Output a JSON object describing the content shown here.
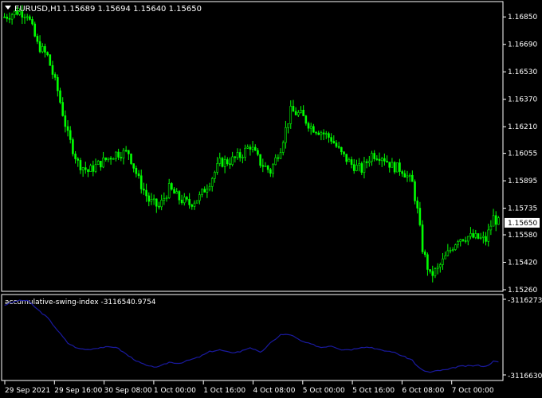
{
  "header": {
    "symbol": "EURUSD,H1",
    "ohlc": "1.15689 1.15694 1.15640 1.15650"
  },
  "price_axis": {
    "ticks": [
      "1.16850",
      "1.16690",
      "1.16530",
      "1.16370",
      "1.16210",
      "1.16055",
      "1.15895",
      "1.15735",
      "1.15580",
      "1.15420",
      "1.15260"
    ],
    "current": "1.15650"
  },
  "indicator": {
    "label": "accumulative-swing-index -3116540.9754",
    "top_value": "-3116273.",
    "bottom_value": "-3116630."
  },
  "time_axis": [
    "29 Sep 2021",
    "29 Sep 16:00",
    "30 Sep 08:00",
    "1 Oct 00:00",
    "1 Oct 16:00",
    "4 Oct 08:00",
    "5 Oct 00:00",
    "5 Oct 16:00",
    "6 Oct 08:00",
    "7 Oct 00:00"
  ],
  "colors": {
    "background": "#000000",
    "candle": "#00ff00",
    "frame": "#ffffff",
    "indicator_line": "#1a1aa0"
  },
  "chart_data": {
    "type": "line",
    "title": "EURUSD,H1",
    "y_range": [
      1.1526,
      1.1693
    ],
    "anchors": [
      {
        "i": 0,
        "p": 1.1685
      },
      {
        "i": 5,
        "p": 1.1688
      },
      {
        "i": 9,
        "p": 1.1687
      },
      {
        "i": 13,
        "p": 1.1669
      },
      {
        "i": 17,
        "p": 1.1662
      },
      {
        "i": 21,
        "p": 1.1642
      },
      {
        "i": 25,
        "p": 1.1616
      },
      {
        "i": 29,
        "p": 1.16
      },
      {
        "i": 33,
        "p": 1.1595
      },
      {
        "i": 38,
        "p": 1.16
      },
      {
        "i": 44,
        "p": 1.16055
      },
      {
        "i": 49,
        "p": 1.1606
      },
      {
        "i": 53,
        "p": 1.159
      },
      {
        "i": 57,
        "p": 1.1578
      },
      {
        "i": 61,
        "p": 1.1574
      },
      {
        "i": 65,
        "p": 1.1585
      },
      {
        "i": 69,
        "p": 1.1579
      },
      {
        "i": 73,
        "p": 1.1576
      },
      {
        "i": 77,
        "p": 1.158
      },
      {
        "i": 81,
        "p": 1.1589
      },
      {
        "i": 85,
        "p": 1.16
      },
      {
        "i": 89,
        "p": 1.1601
      },
      {
        "i": 93,
        "p": 1.1604
      },
      {
        "i": 97,
        "p": 1.161
      },
      {
        "i": 101,
        "p": 1.16
      },
      {
        "i": 105,
        "p": 1.1595
      },
      {
        "i": 109,
        "p": 1.1609
      },
      {
        "i": 113,
        "p": 1.163
      },
      {
        "i": 117,
        "p": 1.1628
      },
      {
        "i": 121,
        "p": 1.1621
      },
      {
        "i": 125,
        "p": 1.1618
      },
      {
        "i": 129,
        "p": 1.1614
      },
      {
        "i": 133,
        "p": 1.1605
      },
      {
        "i": 137,
        "p": 1.1599
      },
      {
        "i": 141,
        "p": 1.1596
      },
      {
        "i": 145,
        "p": 1.1605
      },
      {
        "i": 149,
        "p": 1.1604
      },
      {
        "i": 153,
        "p": 1.1598
      },
      {
        "i": 157,
        "p": 1.1596
      },
      {
        "i": 161,
        "p": 1.1588
      },
      {
        "i": 163,
        "p": 1.1572
      },
      {
        "i": 165,
        "p": 1.155
      },
      {
        "i": 168,
        "p": 1.1534
      },
      {
        "i": 171,
        "p": 1.1538
      },
      {
        "i": 175,
        "p": 1.1547
      },
      {
        "i": 179,
        "p": 1.1556
      },
      {
        "i": 183,
        "p": 1.1557
      },
      {
        "i": 187,
        "p": 1.1556
      },
      {
        "i": 190,
        "p": 1.1555
      },
      {
        "i": 193,
        "p": 1.1568
      },
      {
        "i": 195,
        "p": 1.1565
      }
    ],
    "indicator": {
      "name": "accumulative-swing-index",
      "y_range": [
        -3116630,
        -3116273
      ],
      "anchors": [
        {
          "i": 0,
          "v": -3116300
        },
        {
          "i": 5,
          "v": -3116280
        },
        {
          "i": 9,
          "v": -3116278
        },
        {
          "i": 13,
          "v": -3116320
        },
        {
          "i": 17,
          "v": -3116360
        },
        {
          "i": 21,
          "v": -3116420
        },
        {
          "i": 25,
          "v": -3116480
        },
        {
          "i": 29,
          "v": -3116505
        },
        {
          "i": 33,
          "v": -3116510
        },
        {
          "i": 38,
          "v": -3116500
        },
        {
          "i": 44,
          "v": -3116498
        },
        {
          "i": 49,
          "v": -3116540
        },
        {
          "i": 53,
          "v": -3116570
        },
        {
          "i": 57,
          "v": -3116590
        },
        {
          "i": 61,
          "v": -3116592
        },
        {
          "i": 65,
          "v": -3116570
        },
        {
          "i": 69,
          "v": -3116575
        },
        {
          "i": 73,
          "v": -3116560
        },
        {
          "i": 77,
          "v": -3116545
        },
        {
          "i": 81,
          "v": -3116520
        },
        {
          "i": 85,
          "v": -3116512
        },
        {
          "i": 89,
          "v": -3116525
        },
        {
          "i": 93,
          "v": -3116520
        },
        {
          "i": 97,
          "v": -3116500
        },
        {
          "i": 101,
          "v": -3116525
        },
        {
          "i": 105,
          "v": -3116480
        },
        {
          "i": 109,
          "v": -3116440
        },
        {
          "i": 113,
          "v": -3116440
        },
        {
          "i": 117,
          "v": -3116470
        },
        {
          "i": 121,
          "v": -3116485
        },
        {
          "i": 125,
          "v": -3116500
        },
        {
          "i": 129,
          "v": -3116492
        },
        {
          "i": 133,
          "v": -3116510
        },
        {
          "i": 137,
          "v": -3116510
        },
        {
          "i": 141,
          "v": -3116498
        },
        {
          "i": 145,
          "v": -3116500
        },
        {
          "i": 149,
          "v": -3116515
        },
        {
          "i": 153,
          "v": -3116520
        },
        {
          "i": 157,
          "v": -3116540
        },
        {
          "i": 161,
          "v": -3116560
        },
        {
          "i": 163,
          "v": -3116590
        },
        {
          "i": 165,
          "v": -3116608
        },
        {
          "i": 168,
          "v": -3116618
        },
        {
          "i": 171,
          "v": -3116610
        },
        {
          "i": 175,
          "v": -3116605
        },
        {
          "i": 179,
          "v": -3116590
        },
        {
          "i": 183,
          "v": -3116588
        },
        {
          "i": 187,
          "v": -3116585
        },
        {
          "i": 190,
          "v": -3116590
        },
        {
          "i": 193,
          "v": -3116566
        },
        {
          "i": 195,
          "v": -3116570
        }
      ]
    }
  }
}
